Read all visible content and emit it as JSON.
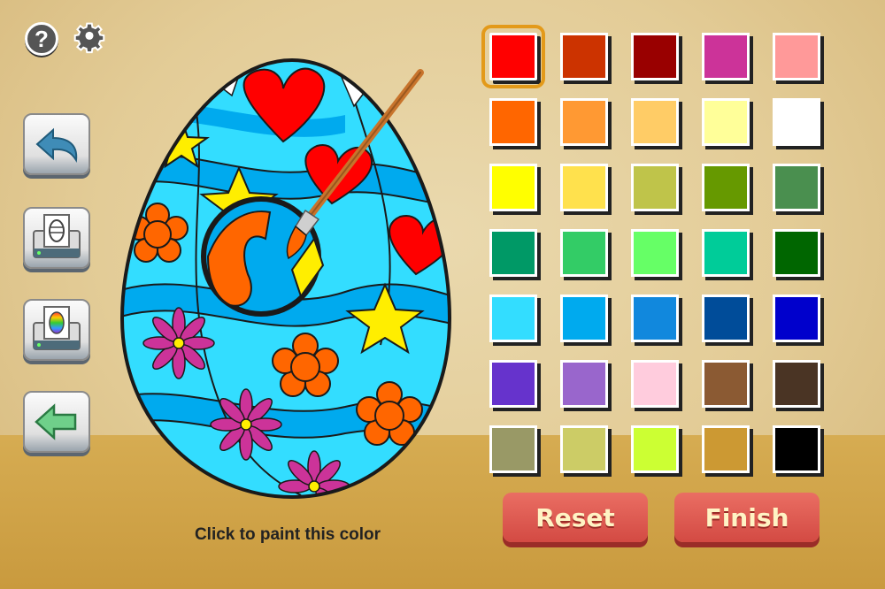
{
  "toolbar": {
    "help_glyph": "?",
    "gear_glyph": "⚙"
  },
  "instruction": "Click to paint this color",
  "buttons": {
    "reset": "Reset",
    "finish": "Finish"
  },
  "palette": {
    "selected_index": 0,
    "colors": [
      "#ff0000",
      "#cc3300",
      "#990000",
      "#cc3399",
      "#ff9999",
      "#ff6600",
      "#ff9933",
      "#ffcc66",
      "#ffff99",
      "#ffffff",
      "#ffff00",
      "#ffe14d",
      "#bfc44a",
      "#669900",
      "#4a8f4f",
      "#009966",
      "#33cc66",
      "#66ff66",
      "#00cc99",
      "#006600",
      "#33ddff",
      "#00aaee",
      "#1188dd",
      "#004c99",
      "#0000cc",
      "#6633cc",
      "#9966cc",
      "#ffccdd",
      "#8b5a33",
      "#4a3424",
      "#999966",
      "#cccc66",
      "#ccff33",
      "#cc9933",
      "#000000"
    ]
  }
}
